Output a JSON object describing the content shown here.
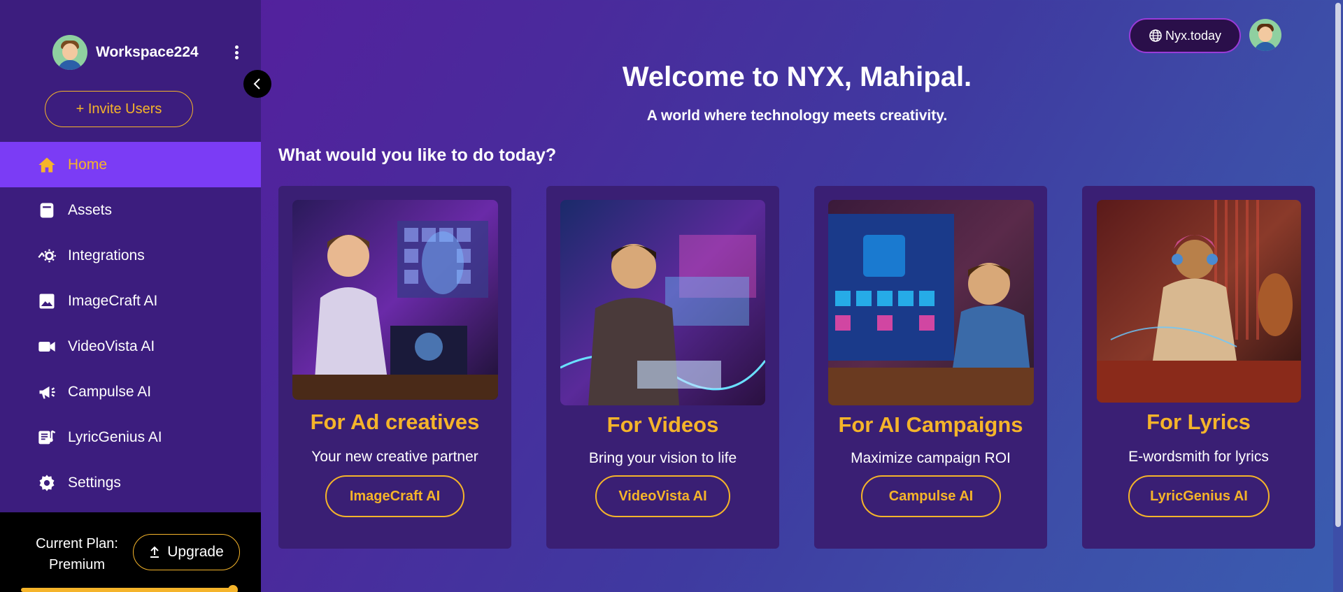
{
  "sidebar": {
    "workspace_name": "Workspace224",
    "invite_label": "+ Invite Users",
    "items": [
      {
        "label": "Home",
        "icon": "home-icon",
        "active": true
      },
      {
        "label": "Assets",
        "icon": "assets-icon"
      },
      {
        "label": "Integrations",
        "icon": "integrations-icon"
      },
      {
        "label": "ImageCraft AI",
        "icon": "image-icon"
      },
      {
        "label": "VideoVista AI",
        "icon": "video-camera-icon"
      },
      {
        "label": "Campulse AI",
        "icon": "megaphone-icon"
      },
      {
        "label": "LyricGenius AI",
        "icon": "lyrics-icon"
      },
      {
        "label": "Settings",
        "icon": "gear-icon"
      }
    ],
    "plan_label": "Current Plan:",
    "plan_value": "Premium",
    "upgrade_label": "Upgrade",
    "plan_usage_fraction": 1.0
  },
  "header": {
    "nyx_button": "Nyx.today",
    "welcome": "Welcome to NYX, Mahipal.",
    "tagline": "A world where technology meets creativity."
  },
  "main": {
    "question": "What would you like to do today?",
    "cards": [
      {
        "title": "For Ad creatives",
        "subtitle": "Your new creative partner",
        "button": "ImageCraft AI"
      },
      {
        "title": "For Videos",
        "subtitle": "Bring your vision to life",
        "button": "VideoVista AI"
      },
      {
        "title": "For AI Campaigns",
        "subtitle": "Maximize campaign ROI",
        "button": "Campulse AI"
      },
      {
        "title": "For Lyrics",
        "subtitle": "E-wordsmith for lyrics",
        "button": "LyricGenius AI"
      }
    ]
  },
  "colors": {
    "accent": "#f5b42a",
    "active_nav": "#7b3cf5",
    "sidebar_bg": "#3c1d7e",
    "card_bg": "#3a1f74"
  }
}
